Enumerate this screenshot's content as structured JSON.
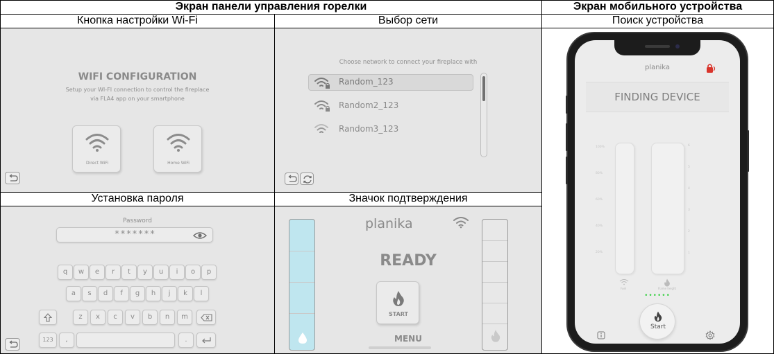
{
  "headers": {
    "burner_panel": "Экран панели управления горелки",
    "mobile_device": "Экран мобильного устройства",
    "wifi_button": "Кнопка настройки Wi-Fi",
    "network_select": "Выбор сети",
    "device_search": "Поиск устройства",
    "password_set": "Установка пароля",
    "confirm_icon": "Значок подтверждения"
  },
  "wifi_config": {
    "title": "WIFI CONFIGURATION",
    "line1": "Setup your WI-FI connection to control the fireplace",
    "line2": "via FLA4 app on your smartphone",
    "direct_label": "Direct WiFi",
    "home_label": "Home WiFi"
  },
  "network": {
    "prompt": "Choose network to connect your fireplace with",
    "networks": [
      "Random_123",
      "Random2_123",
      "Random3_123"
    ]
  },
  "password": {
    "label": "Password",
    "mask": "*******",
    "row1": [
      "q",
      "w",
      "e",
      "r",
      "t",
      "y",
      "u",
      "i",
      "o",
      "p"
    ],
    "row2": [
      "a",
      "s",
      "d",
      "f",
      "g",
      "h",
      "j",
      "k",
      "l"
    ],
    "row3": [
      "z",
      "x",
      "c",
      "v",
      "b",
      "n",
      "m"
    ],
    "num_key": "123",
    "comma_key": ",",
    "dot_key": "."
  },
  "ready": {
    "brand": "planika",
    "status": "READY",
    "start": "START",
    "menu": "MENU"
  },
  "phone": {
    "brand": "planika",
    "status": "FINDING DEVICE",
    "start": "Start",
    "left_ticks": [
      "100%",
      "80%",
      "60%",
      "40%",
      "20%"
    ],
    "right_ticks": [
      "6",
      "5",
      "4",
      "3",
      "2",
      "1"
    ],
    "left_caption": "Fuel",
    "right_caption": "Flame height",
    "dots": "••••••"
  },
  "colors": {
    "screen_bg": "#e6e6e6",
    "fuel_blue": "#bfe6ef",
    "accent_red": "#d9342b",
    "phone_green": "#3fd14a"
  }
}
